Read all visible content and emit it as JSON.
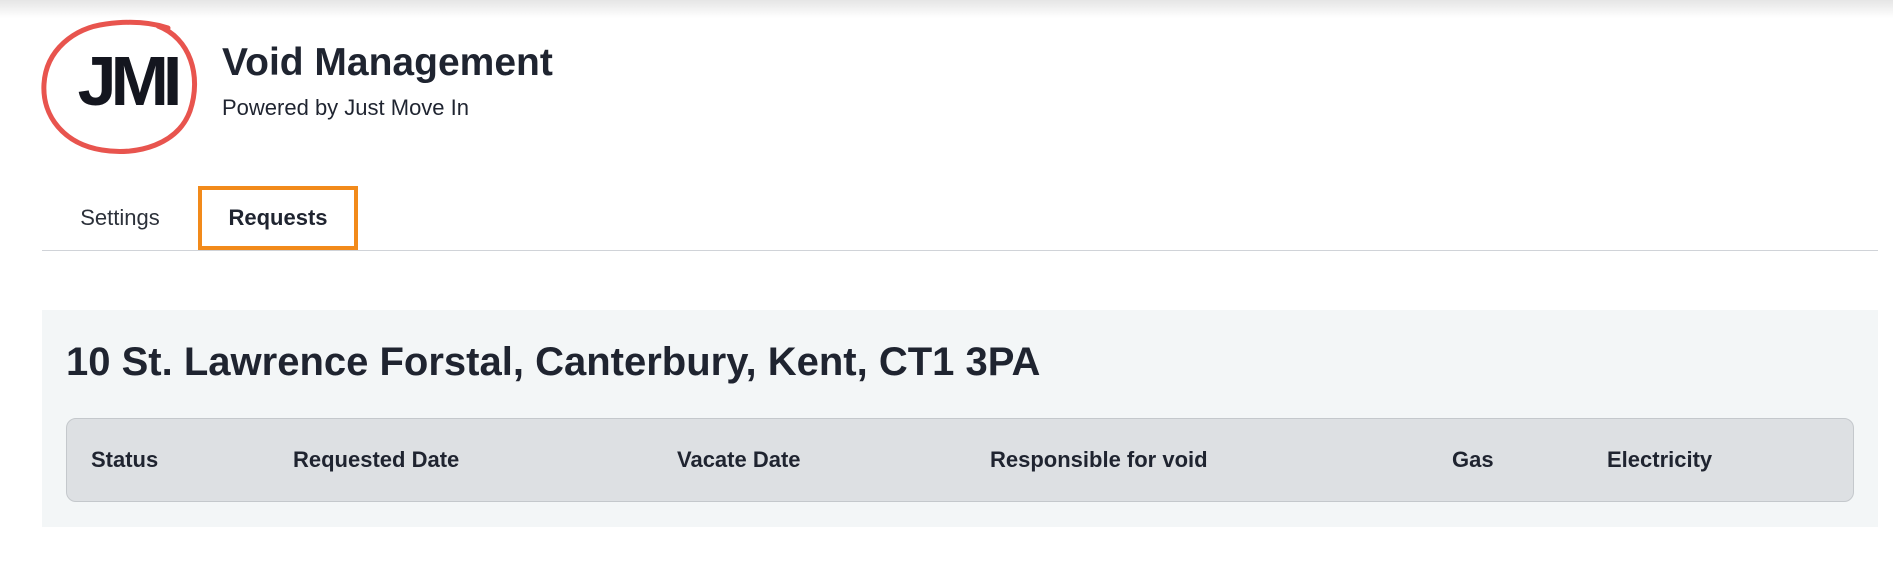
{
  "app": {
    "logo_text": "JMI",
    "title": "Void Management",
    "subtitle": "Powered by Just Move In",
    "accent_color": "#f28a1a",
    "logo_ring_color": "#e8544e"
  },
  "tabs": [
    {
      "label": "Settings",
      "active": false
    },
    {
      "label": "Requests",
      "active": true
    }
  ],
  "property": {
    "address": "10 St. Lawrence Forstal, Canterbury, Kent, CT1 3PA"
  },
  "table": {
    "columns": [
      "Status",
      "Requested Date",
      "Vacate Date",
      "Responsible for void",
      "Gas",
      "Electricity"
    ],
    "rows": []
  }
}
